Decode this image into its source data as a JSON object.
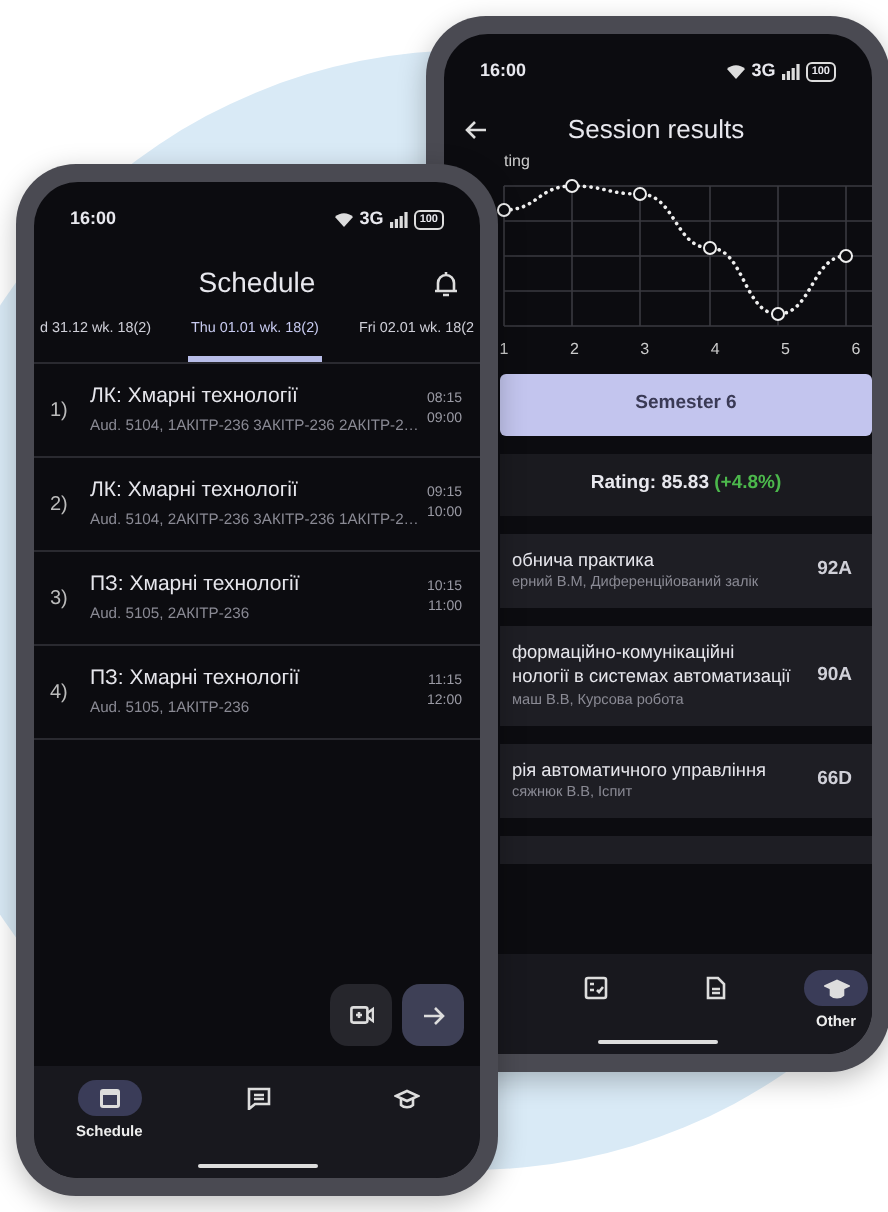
{
  "schedule_screen": {
    "status_bar": {
      "time": "16:00",
      "network": "3G",
      "battery": "100"
    },
    "title": "Schedule",
    "day_tabs": [
      {
        "label": "d 31.12 wk. 18(2)",
        "selected": false
      },
      {
        "label": "Thu 01.01 wk. 18(2)",
        "selected": true
      },
      {
        "label": "Fri 02.01 wk. 18(2",
        "selected": false
      }
    ],
    "lessons": [
      {
        "number": "1)",
        "title": "ЛК: Хмарні технології",
        "details": "Aud. 5104, 1АКІТР-236  3АКІТР-236  2АКІТР-2…",
        "start": "08:15",
        "end": "09:00"
      },
      {
        "number": "2)",
        "title": "ЛК: Хмарні технології",
        "details": "Aud. 5104, 2АКІТР-236  3АКІТР-236  1АКІТР-2…",
        "start": "09:15",
        "end": "10:00"
      },
      {
        "number": "3)",
        "title": "ПЗ: Хмарні технології",
        "details": "Aud. 5105, 2АКІТР-236",
        "start": "10:15",
        "end": "11:00"
      },
      {
        "number": "4)",
        "title": "ПЗ: Хмарні технології",
        "details": "Aud. 5105, 1АКІТР-236",
        "start": "11:15",
        "end": "12:00"
      }
    ],
    "bottom_nav": [
      {
        "kind": "calendar",
        "label": "Schedule",
        "selected": true
      },
      {
        "kind": "chat",
        "selected": false
      },
      {
        "kind": "cap",
        "selected": false
      }
    ]
  },
  "results_screen": {
    "status_bar": {
      "time": "16:00",
      "network": "3G",
      "battery": "100"
    },
    "title": "Session results",
    "chart": {
      "label": "ting",
      "x_labels": [
        "1",
        "2",
        "3",
        "4",
        "5",
        "6"
      ]
    },
    "semester_button": "Semester 6",
    "rating": {
      "text": "Rating: 85.83",
      "change": "(+4.8%)"
    },
    "courses": [
      {
        "title": "обнича практика",
        "details": "ерний В.М, Диференційований залік",
        "grade": "92A"
      },
      {
        "title": "формаційно-комунікаційні\nнології в системах автоматизації",
        "details": "маш В.В, Курсова робота",
        "grade": "90A"
      },
      {
        "title": "рія автоматичного управління",
        "details": "сяжнюк В.В, Іспит",
        "grade": "66D"
      }
    ],
    "bottom_nav": [
      {
        "kind": "checklist",
        "selected": false
      },
      {
        "kind": "document",
        "selected": false
      },
      {
        "kind": "cap",
        "label": "Other",
        "selected": true
      }
    ]
  }
}
